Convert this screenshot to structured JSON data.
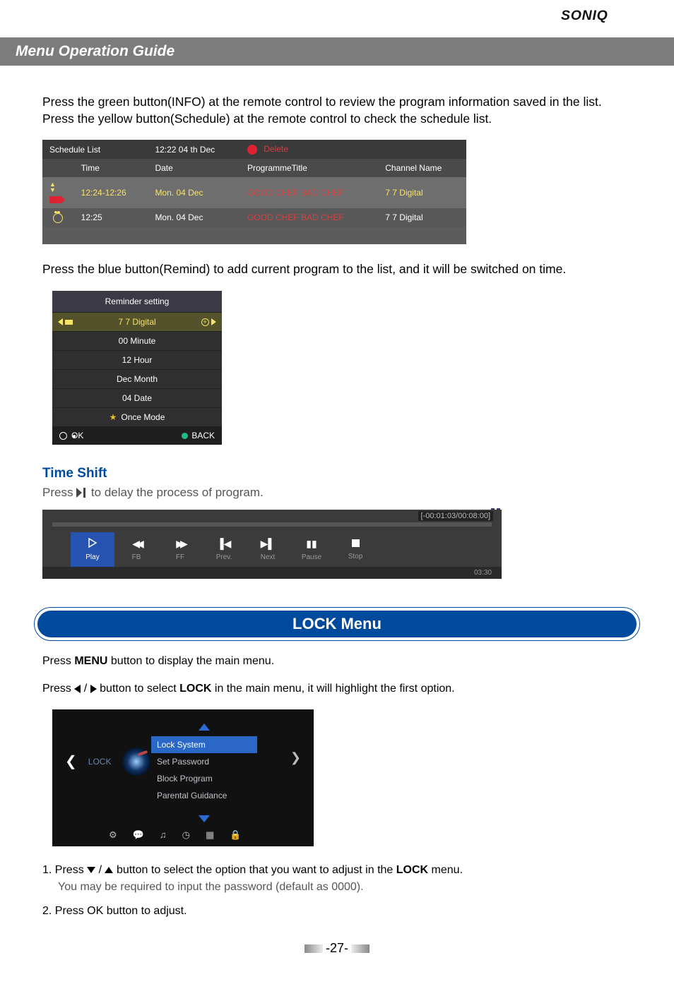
{
  "brand_text": "SONIQ",
  "title_bar": "Menu Operation Guide",
  "intro_para": "Press the green button(INFO) at the remote control to review the program information saved in the list. Press the yellow button(Schedule) at the remote control to check the schedule list.",
  "schedule": {
    "header_left": "Schedule List",
    "header_time": "12:22  04 th Dec",
    "delete_label": "Delete",
    "cols": {
      "time": "Time",
      "date": "Date",
      "prog": "ProgrammeTitle",
      "chan": "Channel Name"
    },
    "rows": [
      {
        "time": "12:24-12:26",
        "date": "Mon. 04 Dec",
        "prog": "GOOD CHEF BAD CHEF",
        "chan": "7 7 Digital",
        "highlight": true,
        "icon": "record"
      },
      {
        "time": "12:25",
        "date": "Mon. 04 Dec",
        "prog": "GOOD CHEF BAD CHEF",
        "chan": "7 7 Digital",
        "highlight": false,
        "icon": "alarm"
      }
    ]
  },
  "remind_para": "Press the blue button(Remind) to add current program to the list, and it will be switched on time.",
  "reminder": {
    "header": "Reminder setting",
    "channel": "7 7 Digital",
    "minute": "00 Minute",
    "hour": "12 Hour",
    "month": "Dec Month",
    "date": "04 Date",
    "mode": "Once Mode",
    "ok": "OK",
    "back": "BACK"
  },
  "time_shift": {
    "heading": "Time Shift",
    "line_pre": "Press ",
    "line_post": " to delay the process of program.",
    "range": "[-00:01:03/00:08:00]",
    "foot_time": "03:30",
    "controls": [
      {
        "name": "play",
        "label": "Play"
      },
      {
        "name": "fb",
        "label": "FB"
      },
      {
        "name": "ff",
        "label": "FF"
      },
      {
        "name": "prev",
        "label": "Prev."
      },
      {
        "name": "next",
        "label": "Next"
      },
      {
        "name": "pause",
        "label": "Pause"
      },
      {
        "name": "stop",
        "label": "Stop"
      }
    ]
  },
  "lock": {
    "menu_title": "LOCK  Menu",
    "p1": "Press MENU button to display the main menu.",
    "p1_pre": "Press ",
    "p1_strong": "MENU",
    "p1_post": " button to display the main menu.",
    "p2_pre": "Press ",
    "p2_mid": " button to select ",
    "p2_strong": "LOCK",
    "p2_post": " in the main menu, it will highlight the first option.",
    "caption": "LOCK",
    "items": [
      "Lock System",
      "Set Password",
      "Block Program",
      "Parental Guidance"
    ],
    "step1_pre": "1. Press ",
    "step1_mid": " button to select the option that you want to adjust in the ",
    "step1_strong": "LOCK",
    "step1_post": " menu.",
    "step1_note": "You may be required to input the password (default as 0000).",
    "step2_pre": "2. Press ",
    "step2_ok": "OK",
    "step2_post": " button to adjust."
  },
  "page_number": "-27-"
}
